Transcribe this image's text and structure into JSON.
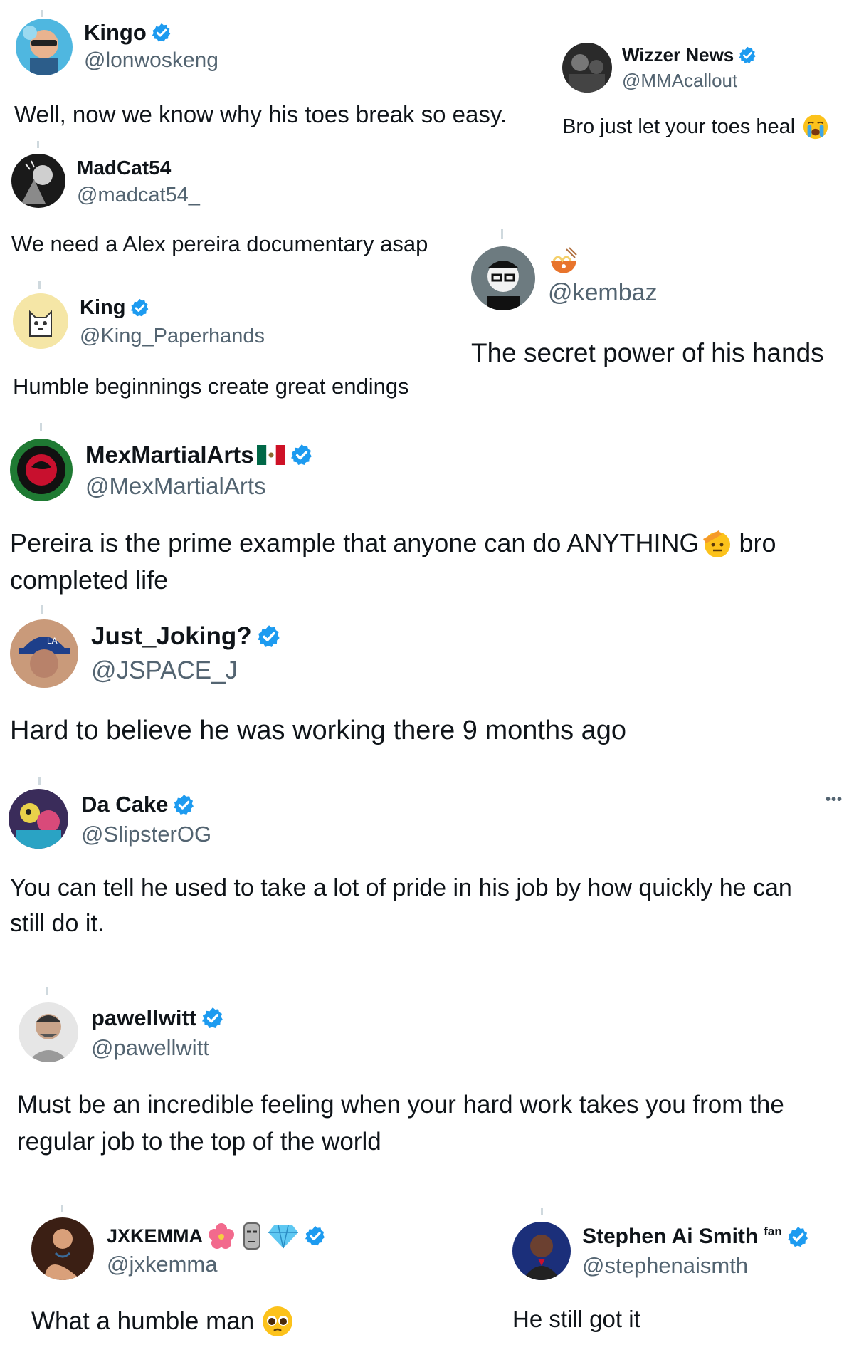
{
  "tweets": [
    {
      "name": "Kingo",
      "handle": "@lonwoskeng",
      "text": "Well, now we know why his toes break so easy."
    },
    {
      "name": "Wizzer News",
      "handle": "@MMAcallout",
      "text": "Bro just let your toes heal"
    },
    {
      "name": "MadCat54",
      "handle": "@madcat54_",
      "text": "We need a Alex pereira documentary asap"
    },
    {
      "name": "",
      "handle": "@kembaz",
      "text": "The secret power of his hands"
    },
    {
      "name": "King",
      "handle": "@King_Paperhands",
      "text": "Humble beginnings create great endings"
    },
    {
      "name": "MexMartialArts",
      "handle": "@MexMartialArts",
      "text_line1": "Pereira is the prime example that anyone can do ANYTHING",
      "text_line1b": "bro",
      "text_line2": "completed life"
    },
    {
      "name": "Just_Joking?",
      "handle": "@JSPACE_J",
      "text": "Hard to believe he was working there 9 months ago"
    },
    {
      "name": "Da Cake",
      "handle": "@SlipsterOG",
      "more": "•••",
      "text_line1": "You can tell he used to take a lot of pride in his job by how quickly he can",
      "text_line2": "still do it."
    },
    {
      "name": "pawellwitt",
      "handle": "@pawellwitt",
      "text_line1": "Must be an incredible feeling when your hard work takes you from the",
      "text_line2": "regular job to the top of the world"
    },
    {
      "name": "JXKEMMA",
      "handle": "@jxkemma",
      "text": "What a humble man"
    },
    {
      "name": "Stephen Ai Smith",
      "name_suffix": "fan",
      "handle": "@stephenaismth",
      "text": "He still got it"
    }
  ],
  "icons": {
    "verified": "verified-badge-icon",
    "emoji_crying": "loudly-crying-face-icon",
    "emoji_noodles": "noodle-bowl-icon",
    "emoji_flag": "mexico-flag-icon",
    "emoji_salute": "saluting-face-icon",
    "emoji_hibiscus": "hibiscus-icon",
    "emoji_moai": "moai-icon",
    "emoji_gem": "gem-icon",
    "emoji_pleading": "pleading-face-icon"
  },
  "colors": {
    "verified": "#1d9bf0",
    "handle": "#536471",
    "text": "#0f1419"
  }
}
